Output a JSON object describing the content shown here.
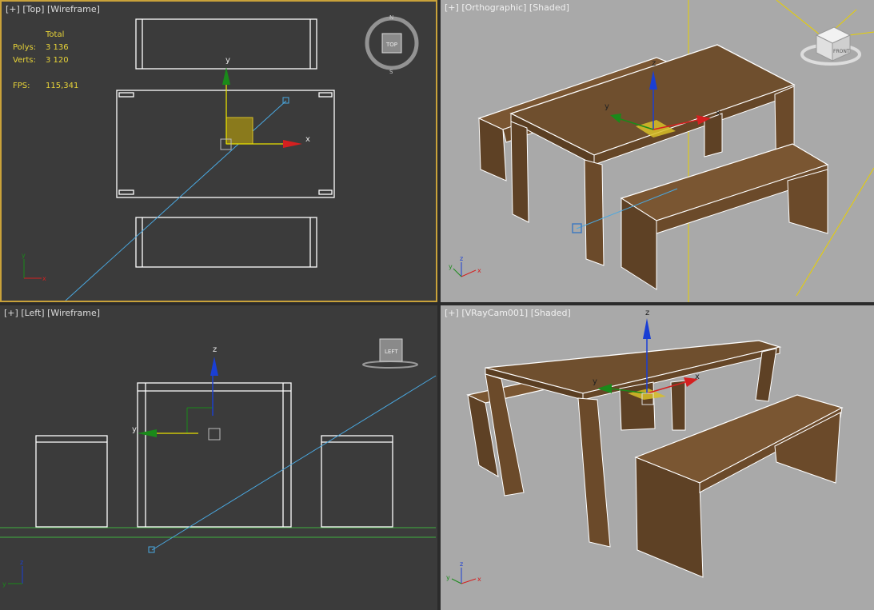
{
  "viewports": {
    "top": {
      "menu": "[+]",
      "view": "[Top]",
      "shading": "[Wireframe]",
      "viewcube_face": "TOP",
      "stats": {
        "header": "Total",
        "polys_label": "Polys:",
        "polys_value": "3 136",
        "verts_label": "Verts:",
        "verts_value": "3 120",
        "fps_label": "FPS:",
        "fps_value": "115,341"
      },
      "gizmo": {
        "x": "x",
        "y": "y"
      }
    },
    "ortho": {
      "menu": "[+]",
      "view": "[Orthographic]",
      "shading": "[Shaded]",
      "viewcube_face": "FRONT",
      "gizmo": {
        "x": "x",
        "y": "y",
        "z": "z"
      }
    },
    "left": {
      "menu": "[+]",
      "view": "[Left]",
      "shading": "[Wireframe]",
      "viewcube_face": "LEFT",
      "gizmo": {
        "y": "y",
        "z": "z"
      }
    },
    "camera": {
      "menu": "[+]",
      "view": "[VRayCam001]",
      "shading": "[Shaded]",
      "gizmo": {
        "x": "x",
        "y": "y",
        "z": "z"
      }
    }
  },
  "colors": {
    "active_border": "#c9a23a",
    "wire": "#ffffff",
    "wood": "#6b4c2c",
    "axis_x": "#d42020",
    "axis_y": "#1a8a1a",
    "axis_z": "#1a3fd4",
    "camera_line": "#4aa8e0",
    "light_line": "#e8d000",
    "stats_text": "#e8d438"
  }
}
